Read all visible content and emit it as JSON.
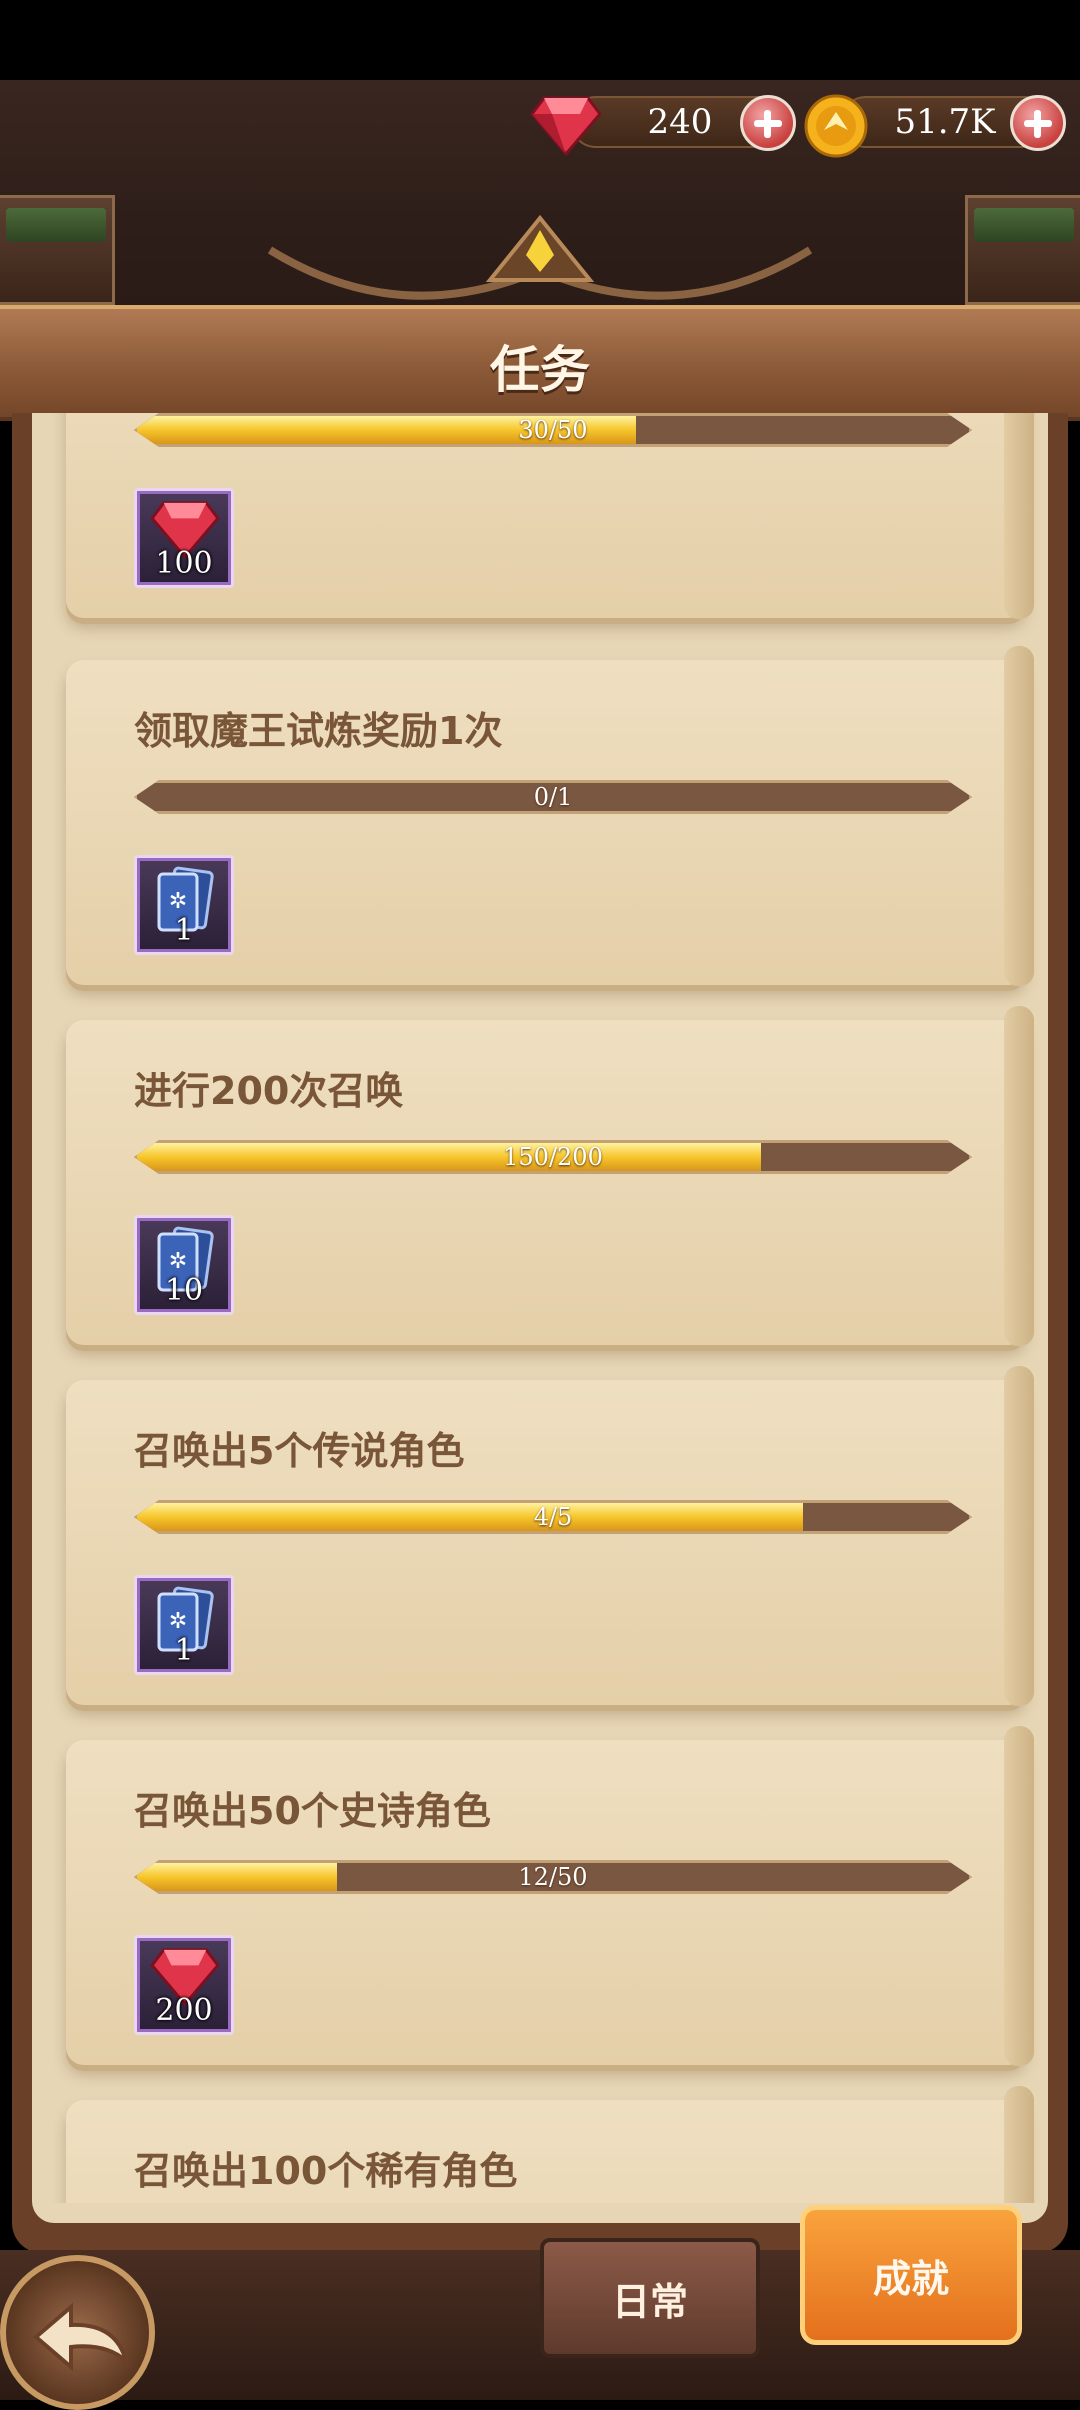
{
  "currencies": {
    "gems": "240",
    "gold": "51.7K"
  },
  "header": {
    "title": "任务"
  },
  "partial_top": {
    "progress": 0.6,
    "progress_text": "30/50",
    "reward_count": "100"
  },
  "quests": [
    {
      "title": "领取魔王试炼奖励1次",
      "progress_text": "0/1",
      "progress": 0.0,
      "reward_icon": "summon-card-icon",
      "reward_count": "1"
    },
    {
      "title": "进行200次召唤",
      "progress_text": "150/200",
      "progress": 0.75,
      "reward_icon": "summon-card-icon",
      "reward_count": "10"
    },
    {
      "title": "召唤出5个传说角色",
      "progress_text": "4/5",
      "progress": 0.8,
      "reward_icon": "summon-card-icon",
      "reward_count": "1"
    },
    {
      "title": "召唤出50个史诗角色",
      "progress_text": "12/50",
      "progress": 0.24,
      "reward_icon": "ruby-gem-icon",
      "reward_count": "200"
    },
    {
      "title": "召唤出100个稀有角色"
    }
  ],
  "tabs": {
    "daily": "日常",
    "achievement": "成就"
  },
  "colors": {
    "accent_orange": "#f08a2c",
    "parchment": "#e7d6b5",
    "progress_gold": "#f6c52b"
  }
}
